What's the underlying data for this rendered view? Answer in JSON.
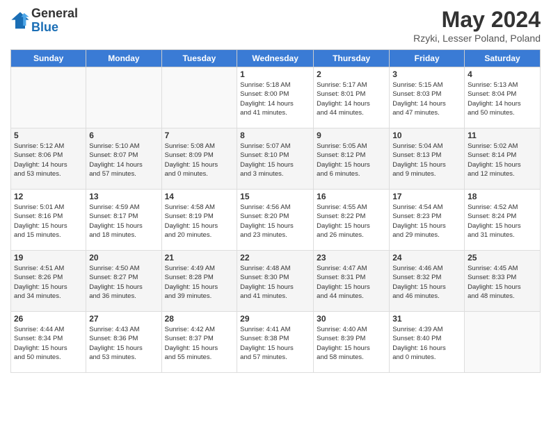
{
  "header": {
    "logo_general": "General",
    "logo_blue": "Blue",
    "month": "May 2024",
    "location": "Rzyki, Lesser Poland, Poland"
  },
  "days_of_week": [
    "Sunday",
    "Monday",
    "Tuesday",
    "Wednesday",
    "Thursday",
    "Friday",
    "Saturday"
  ],
  "weeks": [
    [
      {
        "day": "",
        "info": ""
      },
      {
        "day": "",
        "info": ""
      },
      {
        "day": "",
        "info": ""
      },
      {
        "day": "1",
        "info": "Sunrise: 5:18 AM\nSunset: 8:00 PM\nDaylight: 14 hours\nand 41 minutes."
      },
      {
        "day": "2",
        "info": "Sunrise: 5:17 AM\nSunset: 8:01 PM\nDaylight: 14 hours\nand 44 minutes."
      },
      {
        "day": "3",
        "info": "Sunrise: 5:15 AM\nSunset: 8:03 PM\nDaylight: 14 hours\nand 47 minutes."
      },
      {
        "day": "4",
        "info": "Sunrise: 5:13 AM\nSunset: 8:04 PM\nDaylight: 14 hours\nand 50 minutes."
      }
    ],
    [
      {
        "day": "5",
        "info": "Sunrise: 5:12 AM\nSunset: 8:06 PM\nDaylight: 14 hours\nand 53 minutes."
      },
      {
        "day": "6",
        "info": "Sunrise: 5:10 AM\nSunset: 8:07 PM\nDaylight: 14 hours\nand 57 minutes."
      },
      {
        "day": "7",
        "info": "Sunrise: 5:08 AM\nSunset: 8:09 PM\nDaylight: 15 hours\nand 0 minutes."
      },
      {
        "day": "8",
        "info": "Sunrise: 5:07 AM\nSunset: 8:10 PM\nDaylight: 15 hours\nand 3 minutes."
      },
      {
        "day": "9",
        "info": "Sunrise: 5:05 AM\nSunset: 8:12 PM\nDaylight: 15 hours\nand 6 minutes."
      },
      {
        "day": "10",
        "info": "Sunrise: 5:04 AM\nSunset: 8:13 PM\nDaylight: 15 hours\nand 9 minutes."
      },
      {
        "day": "11",
        "info": "Sunrise: 5:02 AM\nSunset: 8:14 PM\nDaylight: 15 hours\nand 12 minutes."
      }
    ],
    [
      {
        "day": "12",
        "info": "Sunrise: 5:01 AM\nSunset: 8:16 PM\nDaylight: 15 hours\nand 15 minutes."
      },
      {
        "day": "13",
        "info": "Sunrise: 4:59 AM\nSunset: 8:17 PM\nDaylight: 15 hours\nand 18 minutes."
      },
      {
        "day": "14",
        "info": "Sunrise: 4:58 AM\nSunset: 8:19 PM\nDaylight: 15 hours\nand 20 minutes."
      },
      {
        "day": "15",
        "info": "Sunrise: 4:56 AM\nSunset: 8:20 PM\nDaylight: 15 hours\nand 23 minutes."
      },
      {
        "day": "16",
        "info": "Sunrise: 4:55 AM\nSunset: 8:22 PM\nDaylight: 15 hours\nand 26 minutes."
      },
      {
        "day": "17",
        "info": "Sunrise: 4:54 AM\nSunset: 8:23 PM\nDaylight: 15 hours\nand 29 minutes."
      },
      {
        "day": "18",
        "info": "Sunrise: 4:52 AM\nSunset: 8:24 PM\nDaylight: 15 hours\nand 31 minutes."
      }
    ],
    [
      {
        "day": "19",
        "info": "Sunrise: 4:51 AM\nSunset: 8:26 PM\nDaylight: 15 hours\nand 34 minutes."
      },
      {
        "day": "20",
        "info": "Sunrise: 4:50 AM\nSunset: 8:27 PM\nDaylight: 15 hours\nand 36 minutes."
      },
      {
        "day": "21",
        "info": "Sunrise: 4:49 AM\nSunset: 8:28 PM\nDaylight: 15 hours\nand 39 minutes."
      },
      {
        "day": "22",
        "info": "Sunrise: 4:48 AM\nSunset: 8:30 PM\nDaylight: 15 hours\nand 41 minutes."
      },
      {
        "day": "23",
        "info": "Sunrise: 4:47 AM\nSunset: 8:31 PM\nDaylight: 15 hours\nand 44 minutes."
      },
      {
        "day": "24",
        "info": "Sunrise: 4:46 AM\nSunset: 8:32 PM\nDaylight: 15 hours\nand 46 minutes."
      },
      {
        "day": "25",
        "info": "Sunrise: 4:45 AM\nSunset: 8:33 PM\nDaylight: 15 hours\nand 48 minutes."
      }
    ],
    [
      {
        "day": "26",
        "info": "Sunrise: 4:44 AM\nSunset: 8:34 PM\nDaylight: 15 hours\nand 50 minutes."
      },
      {
        "day": "27",
        "info": "Sunrise: 4:43 AM\nSunset: 8:36 PM\nDaylight: 15 hours\nand 53 minutes."
      },
      {
        "day": "28",
        "info": "Sunrise: 4:42 AM\nSunset: 8:37 PM\nDaylight: 15 hours\nand 55 minutes."
      },
      {
        "day": "29",
        "info": "Sunrise: 4:41 AM\nSunset: 8:38 PM\nDaylight: 15 hours\nand 57 minutes."
      },
      {
        "day": "30",
        "info": "Sunrise: 4:40 AM\nSunset: 8:39 PM\nDaylight: 15 hours\nand 58 minutes."
      },
      {
        "day": "31",
        "info": "Sunrise: 4:39 AM\nSunset: 8:40 PM\nDaylight: 16 hours\nand 0 minutes."
      },
      {
        "day": "",
        "info": ""
      }
    ]
  ]
}
